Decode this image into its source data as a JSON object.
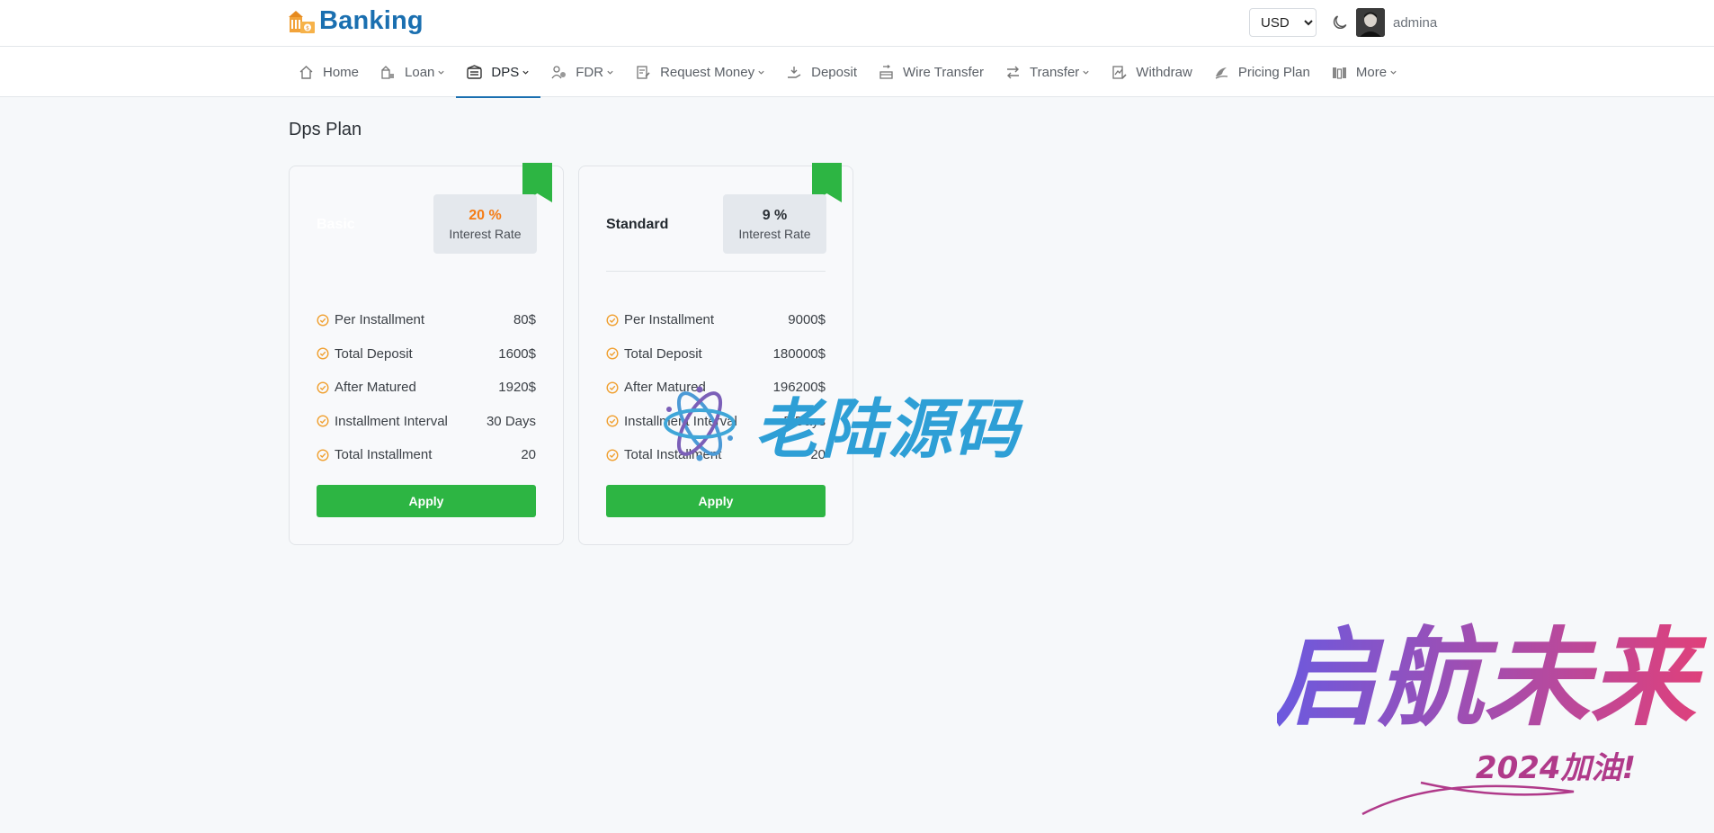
{
  "brand": {
    "name": "Banking",
    "icon": "bank-logo-icon"
  },
  "header": {
    "currency": {
      "selected": "USD",
      "options": [
        "USD"
      ]
    },
    "theme_icon": "moon-icon",
    "user": {
      "name": "admina",
      "avatar_icon": "avatar-icon"
    }
  },
  "nav": {
    "items": [
      {
        "label": "Home",
        "icon": "home-icon",
        "dropdown": false
      },
      {
        "label": "Loan",
        "icon": "loan-icon",
        "dropdown": true
      },
      {
        "label": "DPS",
        "icon": "dps-icon",
        "dropdown": true,
        "active": true
      },
      {
        "label": "FDR",
        "icon": "fdr-icon",
        "dropdown": true
      },
      {
        "label": "Request Money",
        "icon": "request-money-icon",
        "dropdown": true
      },
      {
        "label": "Deposit",
        "icon": "deposit-icon",
        "dropdown": false
      },
      {
        "label": "Wire Transfer",
        "icon": "wire-transfer-icon",
        "dropdown": false
      },
      {
        "label": "Transfer",
        "icon": "transfer-icon",
        "dropdown": true
      },
      {
        "label": "Withdraw",
        "icon": "withdraw-icon",
        "dropdown": false
      },
      {
        "label": "Pricing Plan",
        "icon": "pricing-plan-icon",
        "dropdown": false
      },
      {
        "label": "More",
        "icon": "more-icon",
        "dropdown": true
      }
    ],
    "accent_color": "#1a6fb0"
  },
  "page": {
    "title": "Dps Plan"
  },
  "plans": [
    {
      "name": "Basic",
      "rate": "20 %",
      "rate_label": "Interest Rate",
      "features": [
        {
          "label": "Per Installment",
          "value": "80$"
        },
        {
          "label": "Total Deposit",
          "value": "1600$"
        },
        {
          "label": "After Matured",
          "value": "1920$"
        },
        {
          "label": "Installment Interval",
          "value": "30 Days"
        },
        {
          "label": "Total Installment",
          "value": "20"
        }
      ],
      "button": "Apply"
    },
    {
      "name": "Standard",
      "rate": "9 %",
      "rate_label": "Interest Rate",
      "features": [
        {
          "label": "Per Installment",
          "value": "9000$"
        },
        {
          "label": "Total Deposit",
          "value": "180000$"
        },
        {
          "label": "After Matured",
          "value": "196200$"
        },
        {
          "label": "Installment Interval",
          "value": "5 Days"
        },
        {
          "label": "Total Installment",
          "value": "20"
        }
      ],
      "button": "Apply"
    }
  ],
  "colors": {
    "apply": "#2db543",
    "ribbon": "#2db543",
    "highlight_rate": "#f57c15",
    "check": "#f0a030"
  },
  "watermarks": {
    "center": "老陆源码",
    "corner": "启航未来",
    "corner_sub": "2024加油!"
  }
}
